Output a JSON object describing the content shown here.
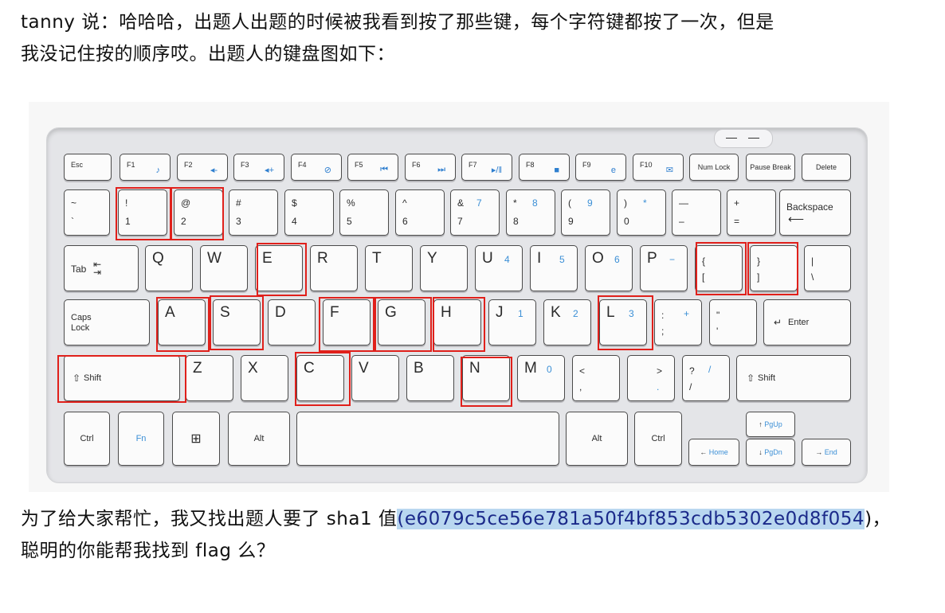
{
  "text": {
    "line1": "tanny 说：哈哈哈，出题人出题的时候被我看到按了那些键，每个字符键都按了一次，但是",
    "line2": "我没记住按的顺序哎。出题人的键盘图如下：",
    "line3_pre": "为了给大家帮忙，我又找出题人要了 sha1 值",
    "line3_hash": "(e6079c5ce56e781a50f4bf853cdb5302e0d8f054",
    "line3_post": ")，",
    "line4": "聪明的你能帮我找到 flag 么？"
  },
  "keys": {
    "esc": "Esc",
    "f1": "F1",
    "f2": "F2",
    "f3": "F3",
    "f4": "F4",
    "f5": "F5",
    "f6": "F6",
    "f7": "F7",
    "f8": "F8",
    "f9": "F9",
    "f10": "F10",
    "numlock": "Num Lock",
    "pause": "Pause Break",
    "delete": "Delete",
    "tilde_top": "~",
    "tilde_bot": "`",
    "n1_top": "!",
    "n1_bot": "1",
    "n2_top": "@",
    "n2_bot": "2",
    "n3_top": "#",
    "n3_bot": "3",
    "n4_top": "$",
    "n4_bot": "4",
    "n5_top": "%",
    "n5_bot": "5",
    "n6_top": "^",
    "n6_bot": "6",
    "n7_top": "&",
    "n7_bot": "7",
    "n7_blue": "7",
    "n8_top": "*",
    "n8_bot": "8",
    "n8_blue": "8",
    "n9_top": "(",
    "n9_bot": "9",
    "n9_blue": "9",
    "n0_top": ")",
    "n0_bot": "0",
    "n0_blue": "*",
    "minus_top": "—",
    "minus_bot": "–",
    "plus_top": "+",
    "plus_bot": "=",
    "backspace": "Backspace",
    "tab": "Tab",
    "q": "Q",
    "w": "W",
    "e": "E",
    "r": "R",
    "t": "T",
    "y": "Y",
    "u": "U",
    "u_blue": "4",
    "i": "I",
    "i_blue": "5",
    "o": "O",
    "o_blue": "6",
    "p": "P",
    "p_blue": "−",
    "lbr_top": "{",
    "lbr_bot": "[",
    "rbr_top": "}",
    "rbr_bot": "]",
    "bsl_top": "|",
    "bsl_bot": "\\",
    "caps": "Caps Lock",
    "a": "A",
    "s": "S",
    "d": "D",
    "f": "F",
    "g": "G",
    "h": "H",
    "j": "J",
    "j_blue": "1",
    "k": "K",
    "k_blue": "2",
    "l": "L",
    "l_blue": "3",
    "semi_top": ":",
    "semi_bot": ";",
    "semi_blue": "+",
    "quote_top": "\"",
    "quote_bot": "'",
    "enter": "Enter",
    "lshift": "Shift",
    "z": "Z",
    "x": "X",
    "c": "C",
    "v": "V",
    "b": "B",
    "n": "N",
    "m": "M",
    "m_blue": "0",
    "comma_top": "<",
    "comma_bot": ",",
    "period_top": ">",
    "period_bot": ".",
    "slash_top": "?",
    "slash_bot": "/",
    "slash_blue": "/",
    "rshift": "Shift",
    "ctrl_l": "Ctrl",
    "fn": "Fn",
    "alt_l": "Alt",
    "alt_r": "Alt",
    "ctrl_r": "Ctrl",
    "pgup": "PgUp",
    "pgdn": "PgDn",
    "home": "Home",
    "end": "End"
  },
  "colors": {
    "highlight": "#e0201b",
    "fn_blue": "#3b8fd6"
  }
}
